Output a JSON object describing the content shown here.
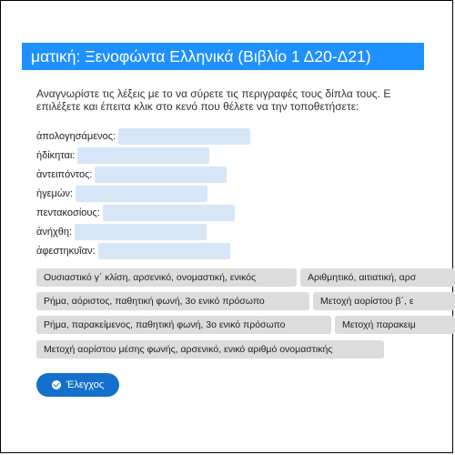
{
  "header": {
    "title": "ματική: Ξενοφώντα Ελληνικά (Βιβλίο 1 Δ20-Δ21)"
  },
  "instructions": {
    "line1": "Αναγνωρίστε τις λέξεις με το να σύρετε τις περιγραφές τους δίπλα τους. Ε",
    "line2": "επιλέξετε και έπειτα κλικ στο κενό που θέλετε να την τοποθετήσετε:"
  },
  "terms": [
    {
      "label": "ἀπολογησάμενος:"
    },
    {
      "label": "ἠδίκηται:"
    },
    {
      "label": "ἀντειπόντος:"
    },
    {
      "label": "ἡγεμών:"
    },
    {
      "label": "πεντακοσίους:"
    },
    {
      "label": "ἀνήχθη:"
    },
    {
      "label": "ἀφεστηκυῖαν:"
    }
  ],
  "options": [
    "Ουσιαστικό γ΄ κλίση, αρσενικό, ονομαστική, ενικός",
    "Αριθμητικό, αιτιατική, αρσ",
    "Ρήμα, αόριστος, παθητική φωνή, 3ο ενικό πρόσωπο",
    "Μετοχή αορίστου β΄, ε",
    "Ρήμα, παρακείμενος, παθητική φωνή, 3ο ενικό πρόσωπο",
    "Μετοχή παρακειμ",
    "Μετοχή αορίστου μέσης φωνής, αρσενικό, ενικό αριθμό ονομαστικής"
  ],
  "check_button": {
    "label": "Έλεγχος",
    "icon": "check-circle-icon"
  },
  "colors": {
    "title_bar": "#1e90ff",
    "drop_target": "#d6e6f6",
    "chip": "#dcdcdc",
    "button": "#1570cc"
  }
}
